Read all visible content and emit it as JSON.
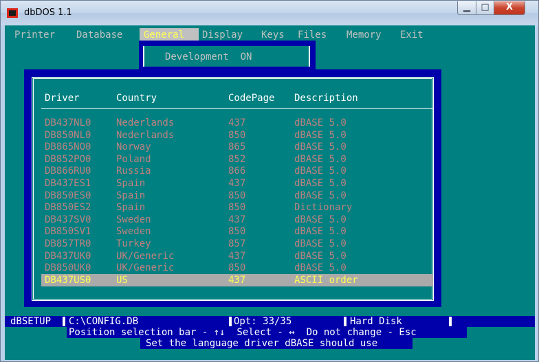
{
  "window": {
    "title": "dbDOS 1.1",
    "minimize": "▁",
    "maximize": "□",
    "close": "X"
  },
  "menu": [
    "Printer",
    "Database",
    "General",
    "Display",
    "Keys",
    "Files",
    "Memory",
    "Exit"
  ],
  "menu_selected": "General",
  "development": "Development  ON",
  "table": {
    "headers": [
      "Driver",
      "Country",
      "CodePage",
      "Description"
    ],
    "rows": [
      [
        "DB437NL0",
        "Nederlands",
        "437",
        "dBASE 5.0"
      ],
      [
        "DB850NL0",
        "Nederlands",
        "850",
        "dBASE 5.0"
      ],
      [
        "DB865NO0",
        "Norway",
        "865",
        "dBASE 5.0"
      ],
      [
        "DB852PO0",
        "Poland",
        "852",
        "dBASE 5.0"
      ],
      [
        "DB866RU0",
        "Russia",
        "866",
        "dBASE 5.0"
      ],
      [
        "DB437ES1",
        "Spain",
        "437",
        "dBASE 5.0"
      ],
      [
        "DB850ES0",
        "Spain",
        "850",
        "dBASE 5.0"
      ],
      [
        "DB850ES2",
        "Spain",
        "850",
        "Dictionary"
      ],
      [
        "DB437SV0",
        "Sweden",
        "437",
        "dBASE 5.0"
      ],
      [
        "DB850SV1",
        "Sweden",
        "850",
        "dBASE 5.0"
      ],
      [
        "DB857TR0",
        "Turkey",
        "857",
        "dBASE 5.0"
      ],
      [
        "DB437UK0",
        "UK/Generic",
        "437",
        "dBASE 5.0"
      ],
      [
        "DB850UK0",
        "UK/Generic",
        "850",
        "dBASE 5.0"
      ],
      [
        "DB437US0",
        "US",
        "437",
        "ASCII order"
      ]
    ],
    "selected_index": 13
  },
  "status": {
    "program": "dBSETUP",
    "file": "C:\\CONFIG.DB",
    "opt": "Opt: 33/35",
    "disk": "Hard Disk"
  },
  "help": {
    "line1": "Position selection bar - ↑↓  Select - ↔  Do not change - Esc",
    "line2": "Set the language driver dBASE should use"
  },
  "colors": {
    "background": "#008080",
    "frame": "#0000aa",
    "selection": "#aaaaaa",
    "row_text": "#c08080",
    "selected_text": "#ffff55"
  }
}
